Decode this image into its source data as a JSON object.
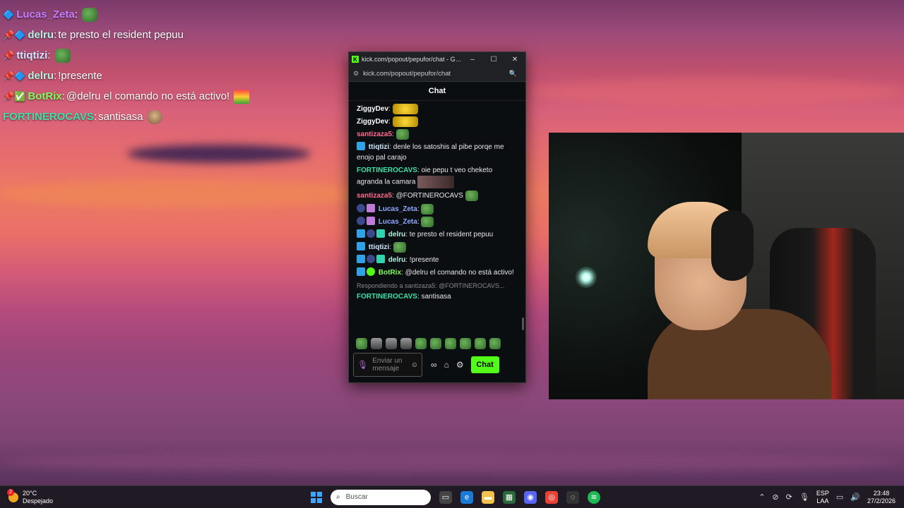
{
  "overlay": {
    "lines": [
      {
        "user": "Lucas_Zeta",
        "sep": ":",
        "message": "",
        "user_color": "#c77dff"
      },
      {
        "user": "delru",
        "sep": ":",
        "message": " te presto el resident pepuu",
        "user_color": "#b2f2e0"
      },
      {
        "user": "ttiqtizi",
        "sep": ":",
        "message": "",
        "user_color": "#cfe6ff"
      },
      {
        "user": "delru",
        "sep": ":",
        "message": " !presente",
        "user_color": "#b2f2e0"
      },
      {
        "user": "BotRix",
        "sep": ":",
        "message": " @delru el comando no está activo!",
        "user_color": "#7dff5a"
      },
      {
        "user": "FORTINEROCAVS",
        "sep": ":",
        "message": " santisasa",
        "user_color": "#3ee0a8"
      }
    ]
  },
  "window": {
    "title": "kick.com/popout/pepufor/chat - Goog...",
    "minimize": "–",
    "maximize": "☐",
    "close": "✕",
    "url": "kick.com/popout/pepufor/chat",
    "chat_header": "Chat"
  },
  "chat": {
    "messages": [
      {
        "user": "ZiggyDev",
        "sep": ":",
        "text": "",
        "color": "#ffffff"
      },
      {
        "user": "ZiggyDev",
        "sep": ":",
        "text": "",
        "color": "#ffffff"
      },
      {
        "user": "santizaza5",
        "sep": ":",
        "text": "",
        "color": "#ff6b8f"
      },
      {
        "user": "ttiqtizi",
        "sep": ":",
        "text": " denle los satoshis al pibe porqe me enojo pal carajo",
        "color": "#cfe6ff"
      },
      {
        "user": "FORTINEROCAVS",
        "sep": ":",
        "text": " oie pepu t veo cheketo agranda la camara",
        "color": "#3ee0a8"
      },
      {
        "user": "santizaza5",
        "sep": ":",
        "text": " @FORTINEROCAVS",
        "color": "#ff6b8f"
      },
      {
        "user": "Lucas_Zeta",
        "sep": ":",
        "text": "",
        "color": "#8fa8ff"
      },
      {
        "user": "Lucas_Zeta",
        "sep": ":",
        "text": "",
        "color": "#8fa8ff"
      },
      {
        "user": "delru",
        "sep": ":",
        "text": " te presto el resident pepuu",
        "color": "#b2f2e0"
      },
      {
        "user": "ttiqtizi",
        "sep": ":",
        "text": "",
        "color": "#cfe6ff"
      },
      {
        "user": "delru",
        "sep": ":",
        "text": " !presente",
        "color": "#b2f2e0"
      },
      {
        "user": "BotRix",
        "sep": ":",
        "text": " @delru el comando no está activo!",
        "color": "#7dff5a"
      }
    ],
    "reply_context": "Respondiendo a santizaza5: @FORTINEROCAVS...",
    "last_message": {
      "user": "FORTINEROCAVS",
      "sep": ":",
      "text": " santisasa",
      "color": "#3ee0a8"
    },
    "input_placeholder": "Enviar un mensaje",
    "send_label": "Chat"
  },
  "taskbar": {
    "weather_temp": "20°C",
    "weather_desc": "Despejado",
    "weather_badge": "2",
    "search_placeholder": "Buscar",
    "lang_top": "ESP",
    "lang_bottom": "LAA",
    "time": "23:48",
    "date": "27/2/2026"
  }
}
